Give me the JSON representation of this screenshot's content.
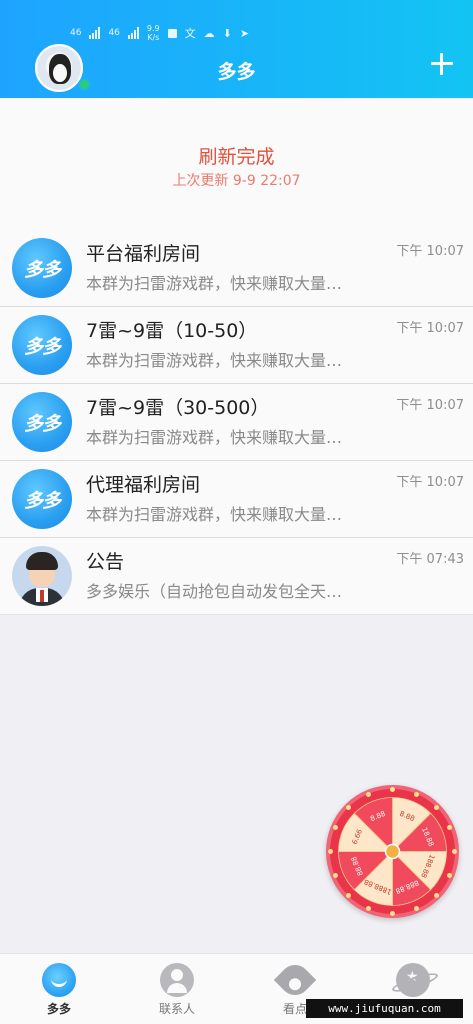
{
  "status_bar": {
    "signal1": "46",
    "signal2": "46",
    "speed_value": "9.9",
    "speed_unit": "K/s"
  },
  "header": {
    "title": "多多",
    "plus_icon": "plus-icon",
    "background_colors": [
      "#1ea4ff",
      "#13c4f3"
    ]
  },
  "refresh": {
    "title": "刷新完成",
    "subtitle": "上次更新 9-9 22:07",
    "color": "#e0523f"
  },
  "conversations": [
    {
      "name": "平台福利房间",
      "message": "本群为扫雷游戏群，快来赚取大量…",
      "time": "下午 10:07",
      "avatar_text": "多多"
    },
    {
      "name": "7雷~9雷（10-50）",
      "message": "本群为扫雷游戏群，快来赚取大量…",
      "time": "下午 10:07",
      "avatar_text": "多多"
    },
    {
      "name": "7雷~9雷（30-500）",
      "message": "本群为扫雷游戏群，快来赚取大量…",
      "time": "下午 10:07",
      "avatar_text": "多多"
    },
    {
      "name": "代理福利房间",
      "message": "本群为扫雷游戏群，快来赚取大量…",
      "time": "下午 10:07",
      "avatar_text": "多多"
    },
    {
      "name": "公告",
      "message": "多多娱乐（自动抢包自动发包全天…",
      "time": "下午 07:43",
      "avatar_text": ""
    }
  ],
  "wheel": {
    "labels": [
      "8.88",
      "18.88",
      "188.88",
      "888.88",
      "1888.88",
      "88.88",
      "6.66",
      "8.88"
    ]
  },
  "tabs": [
    {
      "label": "多多",
      "icon": "duoduo-icon",
      "active": true
    },
    {
      "label": "联系人",
      "icon": "contacts-icon",
      "active": false
    },
    {
      "label": "看点",
      "icon": "eye-icon",
      "active": false
    },
    {
      "label": "",
      "icon": "planet-icon",
      "active": false
    }
  ],
  "watermark": "www.jiufuquan.com"
}
